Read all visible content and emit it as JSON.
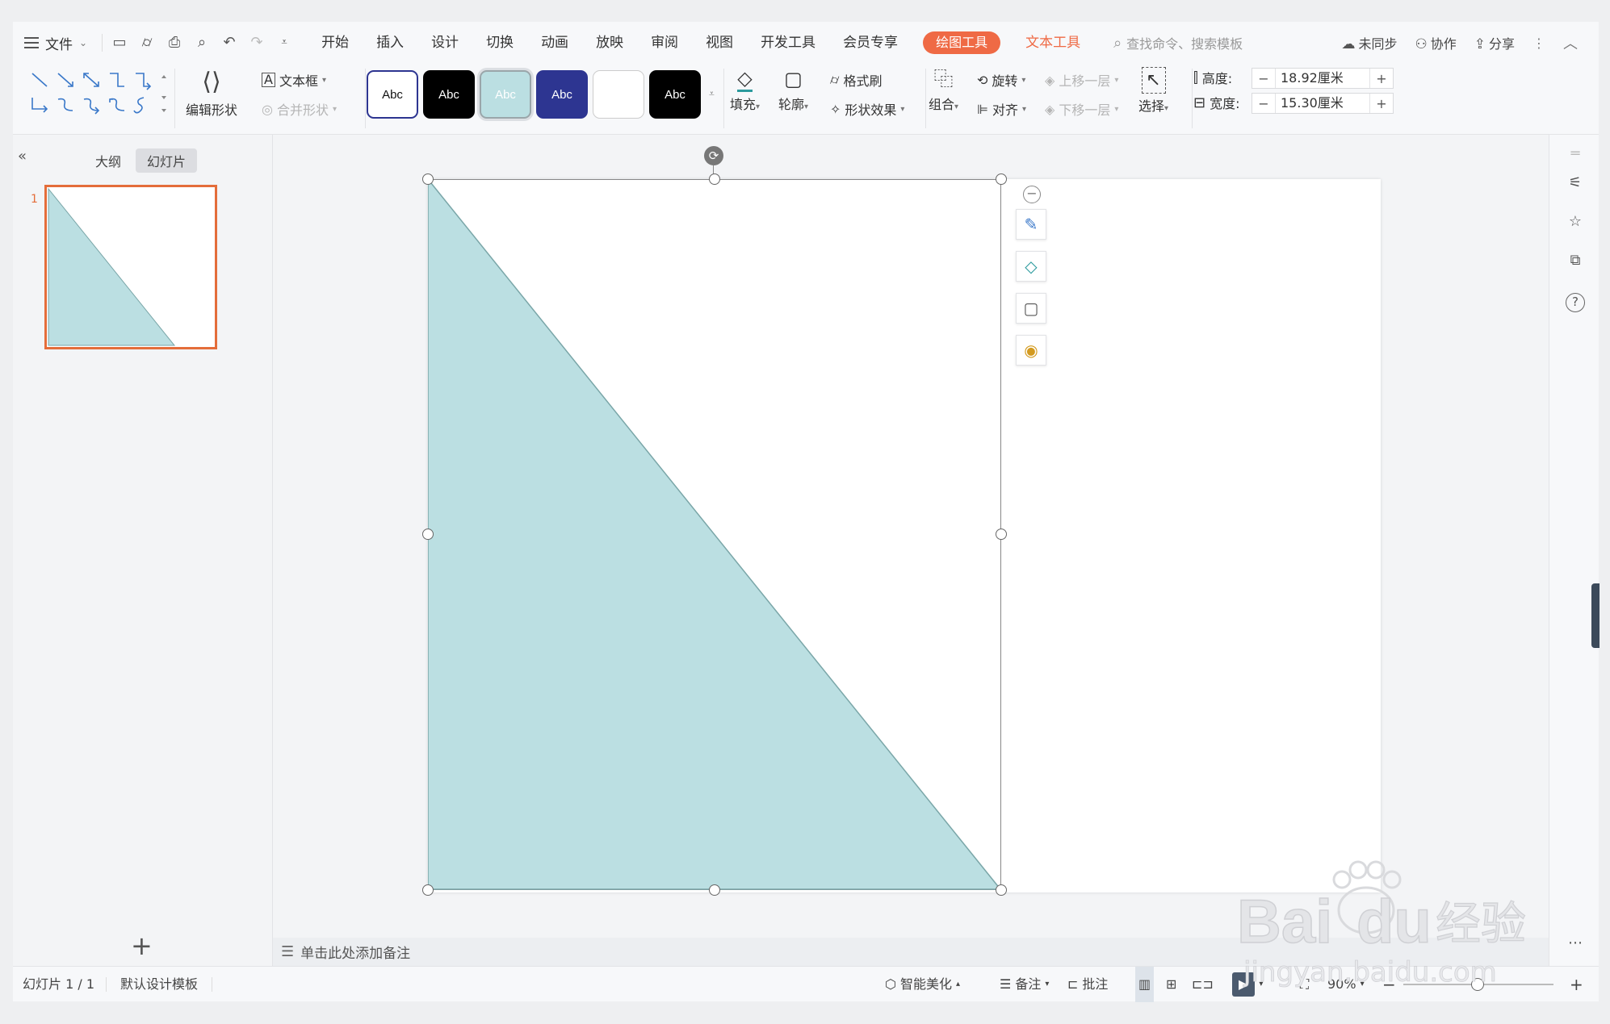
{
  "topbar": {
    "file_menu": "文件",
    "tabs": [
      "开始",
      "插入",
      "设计",
      "切换",
      "动画",
      "放映",
      "审阅",
      "视图",
      "开发工具",
      "会员专享"
    ],
    "active_tab": "绘图工具",
    "text_tools_tab": "文本工具",
    "search_placeholder": "查找命令、搜索模板",
    "sync": "未同步",
    "collab": "协作",
    "share": "分享"
  },
  "ribbon": {
    "edit_shape": "编辑形状",
    "textbox": "文本框",
    "merge_shape": "合并形状",
    "style_label": "Abc",
    "fill": "填充",
    "outline": "轮廓",
    "format_painter": "格式刷",
    "shape_effects": "形状效果",
    "group": "组合",
    "rotate": "旋转",
    "align": "对齐",
    "bring_forward": "上移一层",
    "send_backward": "下移一层",
    "select": "选择",
    "height_label": "高度:",
    "height_value": "18.92厘米",
    "width_label": "宽度:",
    "width_value": "15.30厘米"
  },
  "left_panel": {
    "tab_outline": "大纲",
    "tab_slides": "幻灯片",
    "slide_number": "1"
  },
  "notes": {
    "placeholder": "单击此处添加备注"
  },
  "statusbar": {
    "slide_info": "幻灯片 1 / 1",
    "template": "默认设计模板",
    "beautify": "智能美化",
    "notes": "备注",
    "comments": "批注",
    "zoom": "90%"
  },
  "colors": {
    "shape_fill": "#bbdfe2",
    "shape_stroke": "#7aa6a8",
    "accent": "#ef6a45",
    "dark_blue": "#2d3591"
  },
  "watermark": {
    "text1": "Baidu 经验",
    "text2": "jingyan.baidu.com"
  }
}
